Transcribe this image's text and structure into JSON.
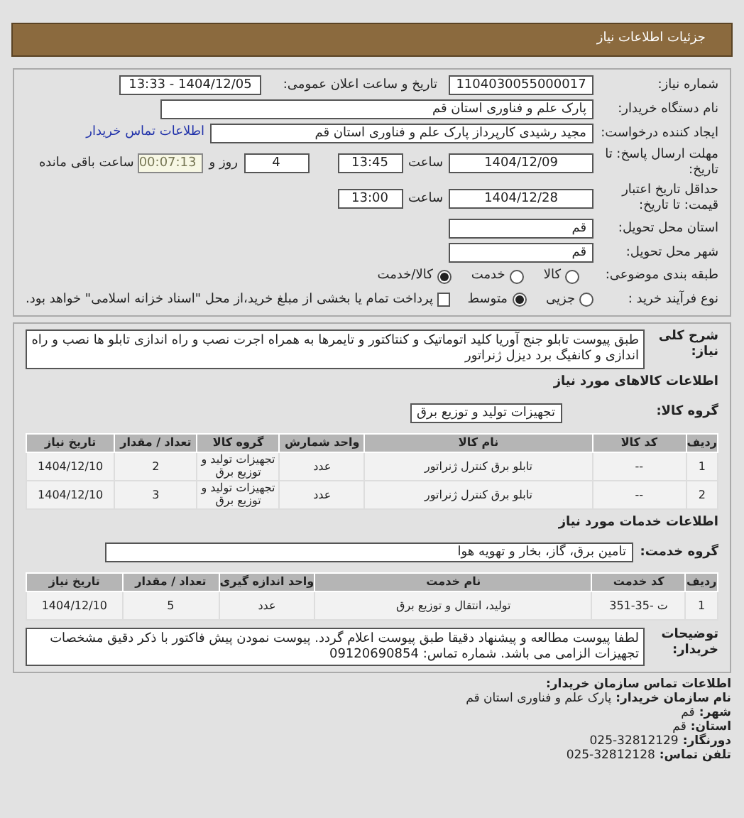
{
  "header": {
    "title": "جزئیات اطلاعات نیاز"
  },
  "need_number": {
    "label": "شماره نیاز:",
    "value": "1104030055000017"
  },
  "announce": {
    "label": "تاریخ و ساعت اعلان عمومی:",
    "value": "1404/12/05 - 13:33"
  },
  "buyer": {
    "label": "نام دستگاه خریدار:",
    "value": "پارک علم و فناوری استان قم"
  },
  "creator": {
    "label": "ایجاد کننده درخواست:",
    "value": "مجید رشیدی کارپرداز پارک علم و فناوری استان قم",
    "link": "اطلاعات تماس خریدار"
  },
  "deadline": {
    "label": "مهلت ارسال پاسخ: تا تاریخ:",
    "date": "1404/12/09",
    "time_label": "ساعت",
    "time": "13:45",
    "days": "4",
    "days_label": "روز و",
    "remaining": "00:07:13",
    "remaining_label": "ساعت باقی مانده"
  },
  "validity": {
    "label": "حداقل تاریخ اعتبار قیمت: تا تاریخ:",
    "date": "1404/12/28",
    "time_label": "ساعت",
    "time": "13:00"
  },
  "province": {
    "label": "استان محل تحویل:",
    "value": "قم"
  },
  "city": {
    "label": "شهر محل تحویل:",
    "value": "قم"
  },
  "category": {
    "label": "طبقه بندی موضوعی:",
    "options": [
      {
        "label": "کالا",
        "selected": false
      },
      {
        "label": "خدمت",
        "selected": false
      },
      {
        "label": "کالا/خدمت",
        "selected": true
      }
    ]
  },
  "process": {
    "label": "نوع فرآیند خرید :",
    "options": [
      {
        "label": "جزیی",
        "selected": false
      },
      {
        "label": "متوسط",
        "selected": true
      }
    ],
    "payment": {
      "checked": false,
      "text": "پرداخت تمام یا بخشی از مبلغ خرید،از محل \"اسناد خزانه اسلامی\" خواهد بود."
    }
  },
  "description": {
    "label": "شرح کلی نیاز:",
    "value": "طبق پیوست تابلو جنج آوریا کلید اتوماتیک و کنتاکتور و تایمرها به همراه اجرت نصب و راه اندازی تابلو ها نصب و راه اندازی و کانفیگ برد دیزل ژنراتور"
  },
  "goods": {
    "title": "اطلاعات کالاهای مورد نیاز",
    "group_label": "گروه کالا:",
    "group": "تجهیزات تولید و توزیع برق",
    "columns": [
      "ردیف",
      "کد کالا",
      "نام کالا",
      "واحد شمارش",
      "گروه کالا",
      "تعداد / مقدار",
      "تاریخ نیاز"
    ],
    "rows": [
      [
        "1",
        "--",
        "تابلو برق کنترل ژنراتور",
        "عدد",
        "تجهیزات تولید و توزیع برق",
        "2",
        "1404/12/10"
      ],
      [
        "2",
        "--",
        "تابلو برق کنترل ژنراتور",
        "عدد",
        "تجهیزات تولید و توزیع برق",
        "3",
        "1404/12/10"
      ]
    ]
  },
  "services": {
    "title": "اطلاعات خدمات مورد نیاز",
    "group_label": "گروه خدمت:",
    "group": "تامین برق، گاز، بخار و تهویه هوا",
    "columns": [
      "ردیف",
      "کد خدمت",
      "نام خدمت",
      "واحد اندازه گیری",
      "تعداد / مقدار",
      "تاریخ نیاز"
    ],
    "rows": [
      [
        "1",
        "ت -35-351",
        "تولید، انتقال و توزیع برق",
        "عدد",
        "5",
        "1404/12/10"
      ]
    ]
  },
  "notes": {
    "label": "توضیحات خریدار:",
    "value": "لطفا پیوست مطالعه و پیشنهاد دقیقا طبق پیوست اعلام گردد. پیوست نمودن پیش فاکتور با ذکر دقیق مشخصات تجهیزات الزامی می باشد. شماره تماس: 09120690854"
  },
  "contact": {
    "title": "اطلاعات تماس سازمان خریدار:",
    "lines": [
      {
        "label": "نام سازمان خریدار:",
        "value": "پارک علم و فناوری استان قم"
      },
      {
        "label": "شهر:",
        "value": "قم"
      },
      {
        "label": "استان:",
        "value": "قم"
      },
      {
        "label": "دورنگار:",
        "value": "025-32812129"
      },
      {
        "label": "تلفن تماس:",
        "value": "025-32812128"
      }
    ]
  }
}
